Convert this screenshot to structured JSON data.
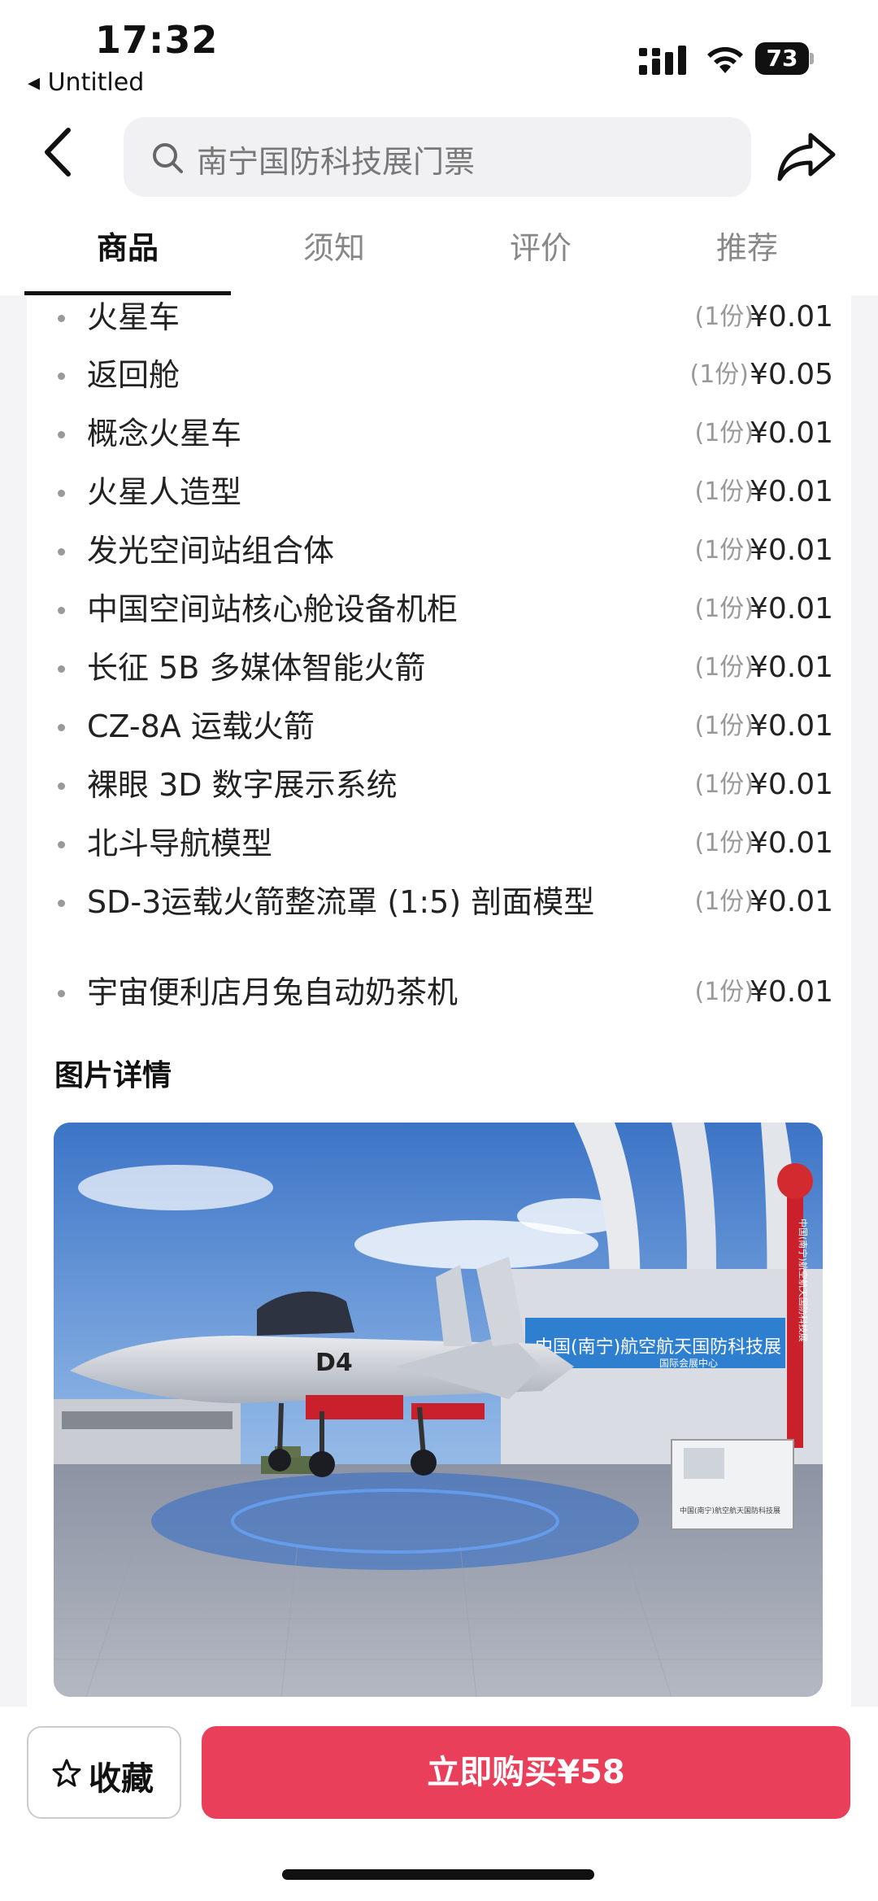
{
  "status": {
    "time": "17:32",
    "back_app": "◂ Untitled",
    "battery": "73"
  },
  "search": {
    "placeholder": "南宁国防科技展门票"
  },
  "tabs": [
    {
      "label": "商品",
      "active": true
    },
    {
      "label": "须知",
      "active": false
    },
    {
      "label": "评价",
      "active": false
    },
    {
      "label": "推荐",
      "active": false
    }
  ],
  "items": [
    {
      "name": "火星车",
      "qty": "(1份)",
      "price": "¥0.01"
    },
    {
      "name": "返回舱",
      "qty": "(1份)",
      "price": "¥0.05"
    },
    {
      "name": "概念火星车",
      "qty": "(1份)",
      "price": "¥0.01"
    },
    {
      "name": "火星人造型",
      "qty": "(1份)",
      "price": "¥0.01"
    },
    {
      "name": "发光空间站组合体",
      "qty": "(1份)",
      "price": "¥0.01"
    },
    {
      "name": "中国空间站核心舱设备机柜",
      "qty": "(1份)",
      "price": "¥0.01"
    },
    {
      "name": "长征 5B 多媒体智能火箭",
      "qty": "(1份)",
      "price": "¥0.01"
    },
    {
      "name": "CZ-8A 运载火箭",
      "qty": "(1份)",
      "price": "¥0.01"
    },
    {
      "name": "裸眼 3D 数字展示系统",
      "qty": "(1份)",
      "price": "¥0.01"
    },
    {
      "name": "北斗导航模型",
      "qty": "(1份)",
      "price": "¥0.01"
    },
    {
      "name": "SD-3运载火箭整流罩 (1:5) 剖面模型",
      "qty": "(1份)",
      "price": "¥0.01"
    },
    {
      "name": "宇宙便利店月兔自动奶茶机",
      "qty": "(1份)",
      "price": "¥0.01"
    }
  ],
  "section_title": "图片详情",
  "photo": {
    "aircraft_code": "D4",
    "banner_text": "中国(南宁)航空航天国防科技展",
    "banner_subtext": "国际会展中心",
    "column_text": "中国(南宁)航空航天国防科技展",
    "sign_text": "中国(南宁)航空航天国防科技展"
  },
  "bottom": {
    "fav_label": "收藏",
    "buy_label": "立即购买¥58"
  },
  "colors": {
    "accent": "#ea3f5b",
    "background": "#f4f4f6"
  }
}
